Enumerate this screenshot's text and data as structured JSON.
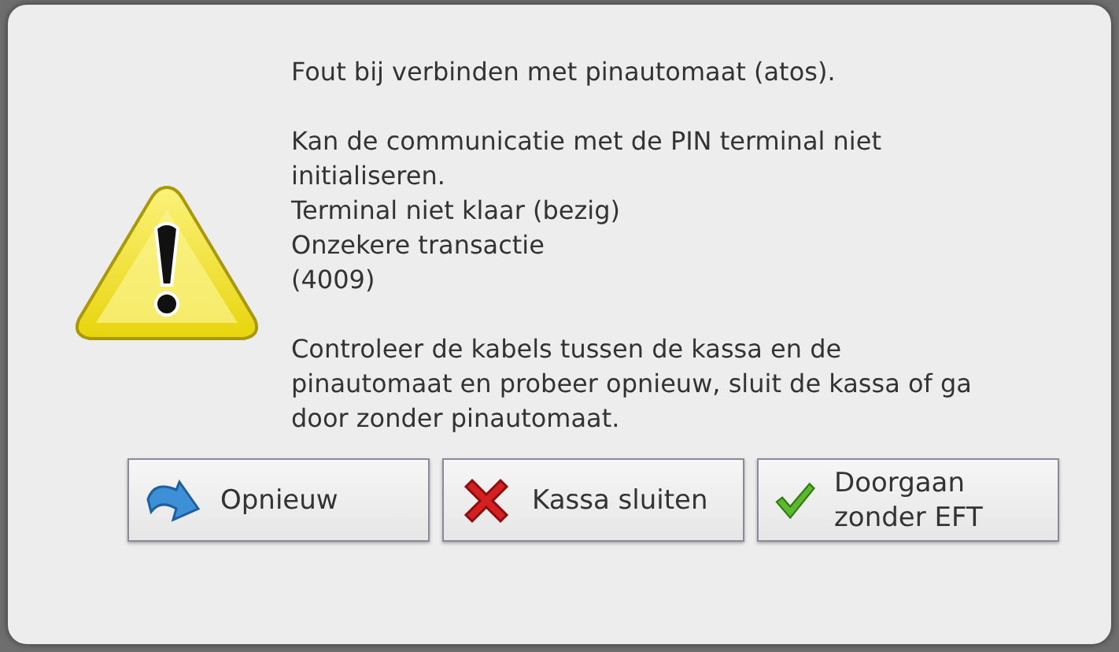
{
  "dialog": {
    "kind": "warning",
    "message": [
      [
        "Fout bij verbinden met pinautomaat (atos)."
      ],
      [
        "Kan de communicatie met de PIN terminal niet initialiseren.",
        "Terminal niet klaar (bezig)",
        "Onzekere transactie",
        "(4009)"
      ],
      [
        "Controleer de kabels tussen de kassa en de pinautomaat en probeer opnieuw, sluit de kassa of ga door zonder pinautomaat."
      ]
    ],
    "buttons": [
      {
        "kind": "retry",
        "label": "Opnieuw"
      },
      {
        "kind": "close",
        "label": "Kassa sluiten"
      },
      {
        "kind": "continue",
        "label": "Doorgaan zonder EFT"
      }
    ]
  }
}
